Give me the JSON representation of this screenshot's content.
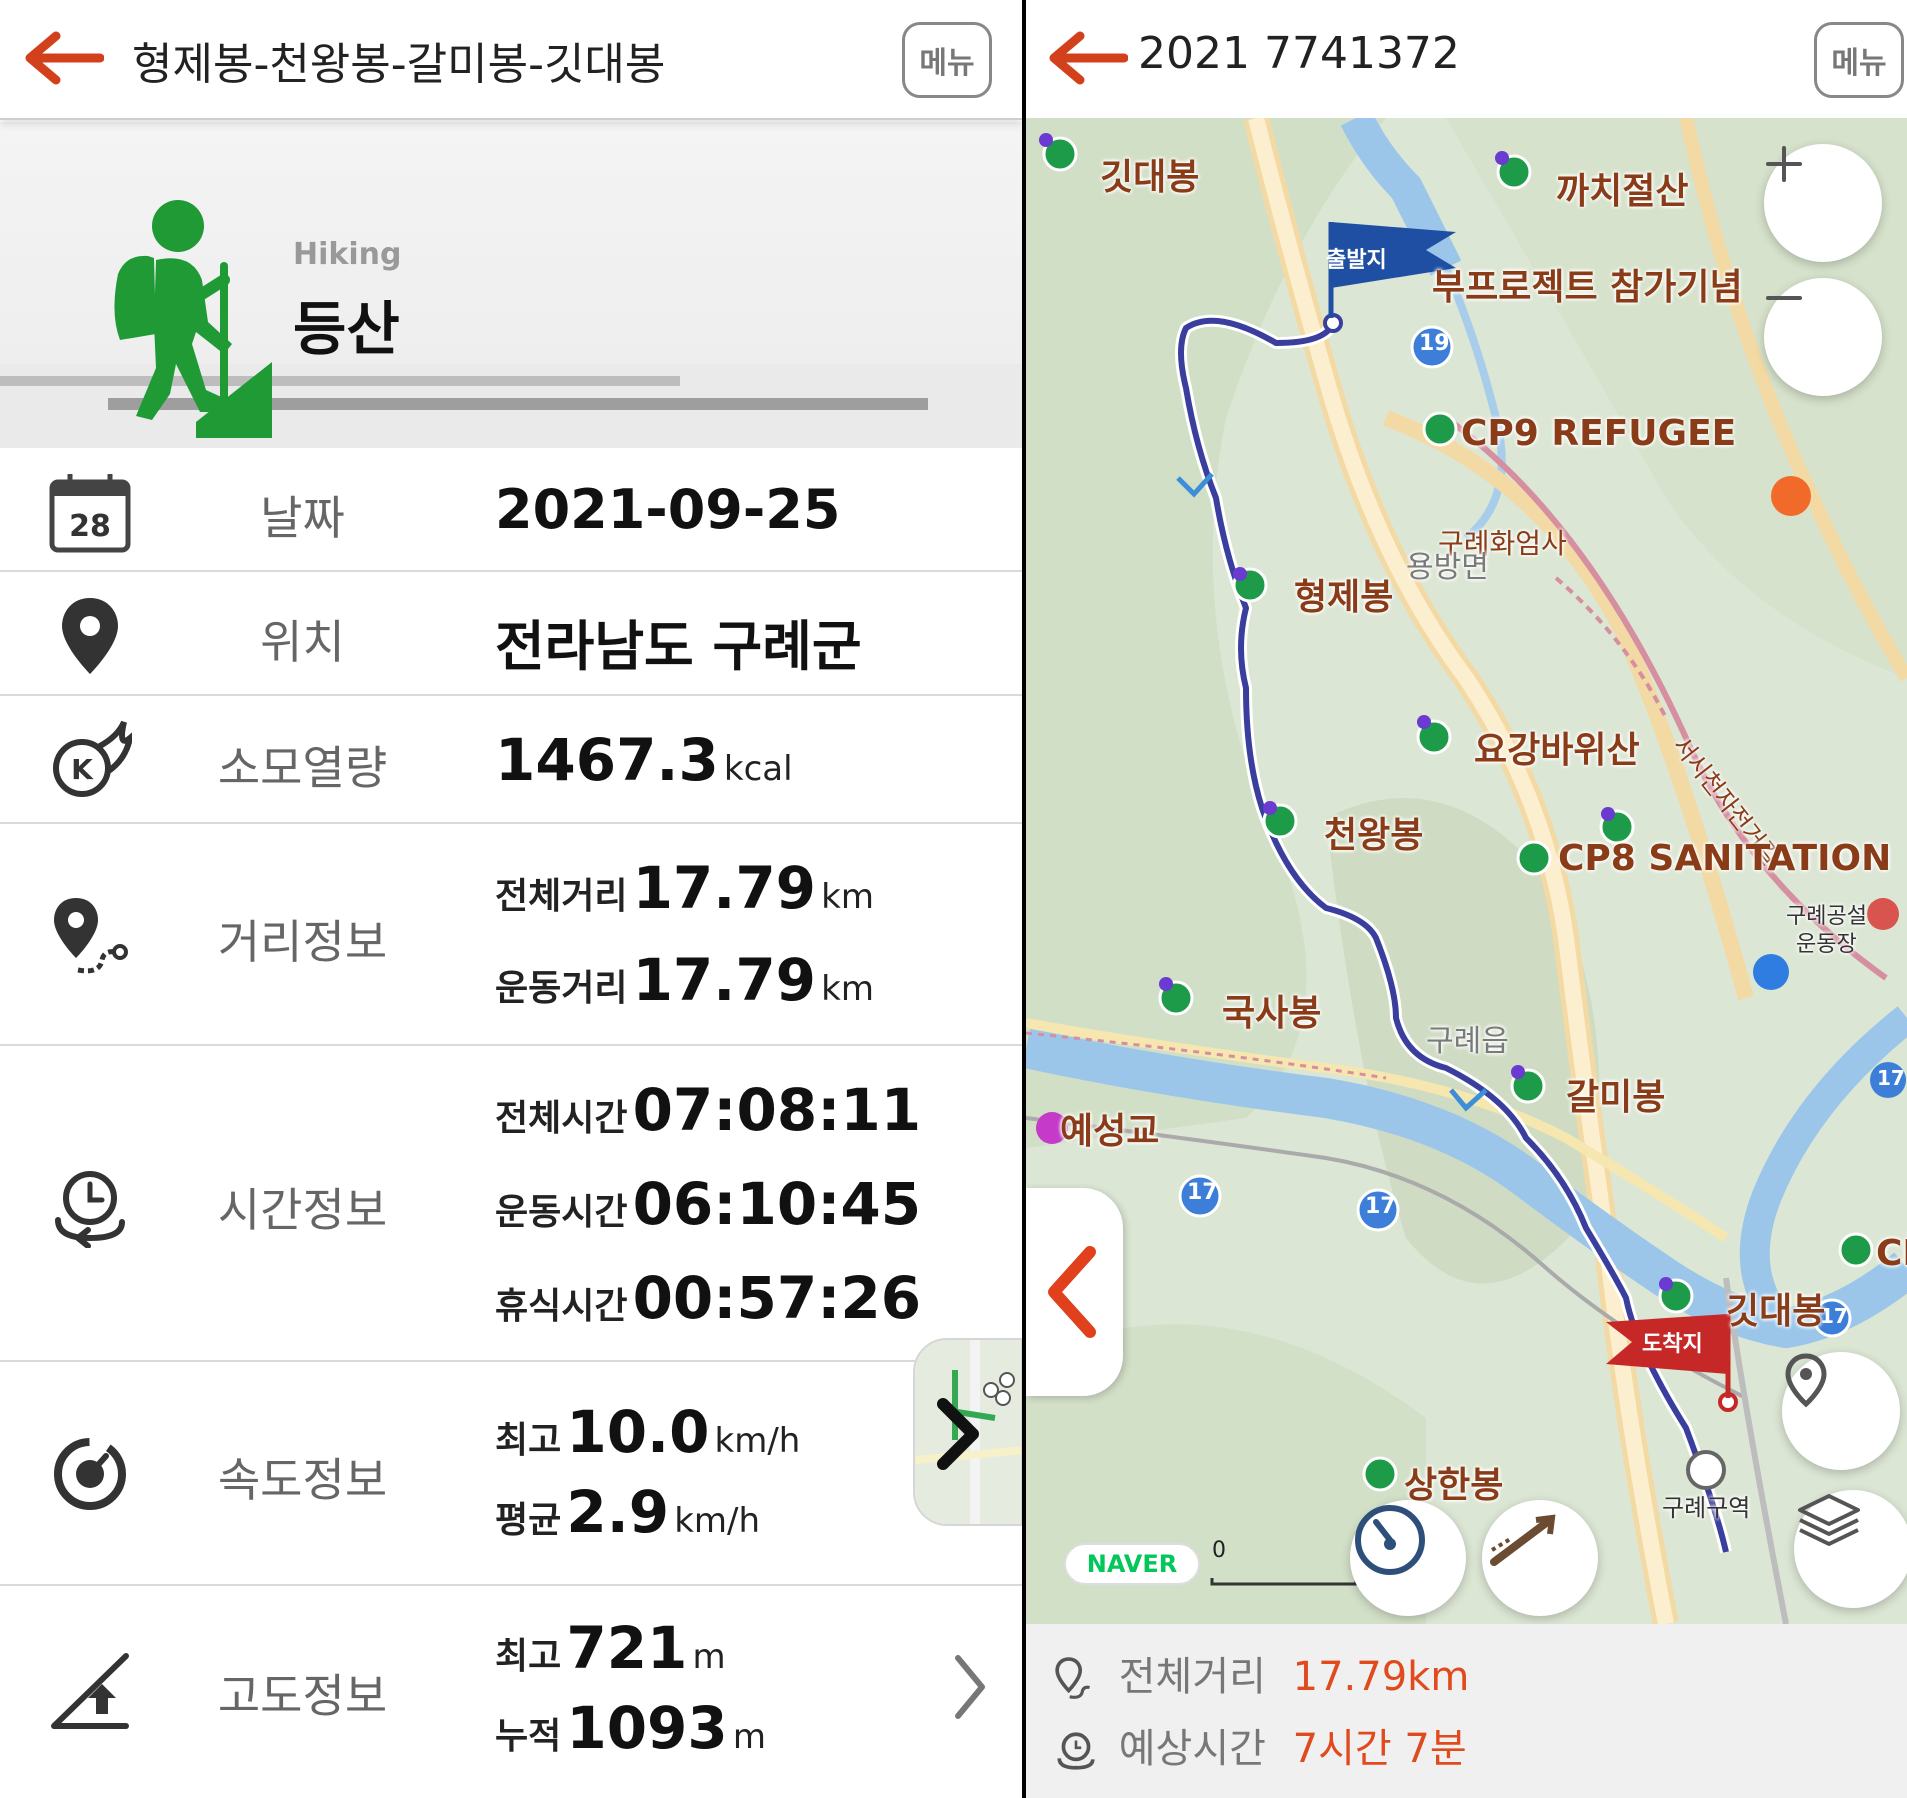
{
  "left": {
    "title": "형제봉-천왕봉-갈미봉-깃대봉",
    "menu_label": "메뉴",
    "activity_en": "Hiking",
    "activity_ko": "등산",
    "calendar_day": "28",
    "date": {
      "label": "날짜",
      "value": "2021-09-25"
    },
    "location": {
      "label": "위치",
      "value": "전라남도 구례군"
    },
    "calories": {
      "label": "소모열량",
      "value": "1467.3",
      "unit": "kcal"
    },
    "distance": {
      "label": "거리정보",
      "total_label": "전체거리",
      "total_value": "17.79",
      "total_unit": "km",
      "moving_label": "운동거리",
      "moving_value": "17.79",
      "moving_unit": "km"
    },
    "time": {
      "label": "시간정보",
      "total_label": "전체시간",
      "total_value": "07:08:11",
      "moving_label": "운동시간",
      "moving_value": "06:10:45",
      "rest_label": "휴식시간",
      "rest_value": "00:57:26"
    },
    "speed": {
      "label": "속도정보",
      "max_label": "최고",
      "max_value": "10.0",
      "max_unit": "km/h",
      "avg_label": "평균",
      "avg_value": "2.9",
      "avg_unit": "km/h"
    },
    "altitude": {
      "label": "고도정보",
      "max_label": "최고",
      "max_value": "721",
      "max_unit": "m",
      "cum_label": "누적",
      "cum_value": "1093",
      "cum_unit": "m"
    }
  },
  "right": {
    "title": "2021 7741372",
    "menu_label": "메뉴",
    "map": {
      "start_flag": "출발지",
      "end_flag": "도착지",
      "naver": "NAVER",
      "scale_zero": "0",
      "labels": {
        "gitdaebong_top": "깃대봉",
        "kkachi": "까치절산",
        "project": "부프로젝트 참가기념",
        "cp9": "CP9 REFUGEE",
        "ic": "구례화엄사",
        "yongbang": "용방면",
        "hyeongje": "형제봉",
        "yogang": "요강바위산",
        "seoshi": "서시천자전거길",
        "cheonwang": "천왕봉",
        "cp8": "CP8 SANITATION",
        "gongseol": "구례공설",
        "undongjang": "운동장",
        "guksa": "국사봉",
        "gurye_eup": "구례읍",
        "galmi": "갈미봉",
        "yeseong": "예성교",
        "gitdaebong_bottom": "깃대봉",
        "sanghan": "상한봉",
        "station": "구례구역",
        "cp_partial": "CP"
      },
      "road_numbers": [
        "19",
        "17",
        "17",
        "17",
        "17"
      ]
    },
    "footer": {
      "distance_label": "전체거리",
      "distance_value": "17.79km",
      "eta_label": "예상시간",
      "eta_value": "7시간 7분"
    }
  },
  "colors": {
    "accent_red": "#d2401c",
    "hiker_green": "#1f9a35",
    "route_blue": "#3a3f9e",
    "start_flag_blue": "#1f4fa3",
    "end_flag_red": "#c62828",
    "value_orange": "#e04a1c"
  }
}
